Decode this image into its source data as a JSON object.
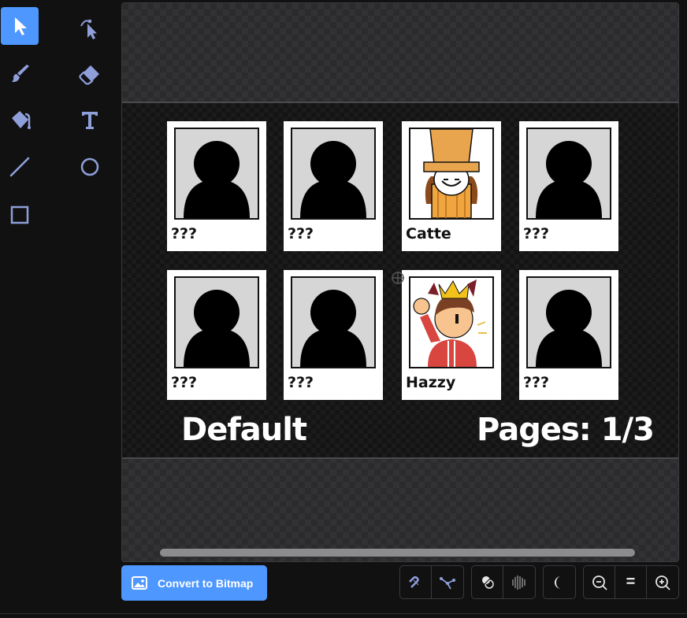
{
  "toolbar": {
    "tools": [
      {
        "name": "select",
        "icon": "arrow-icon",
        "selected": true
      },
      {
        "name": "reshape",
        "icon": "reshape-icon",
        "selected": false
      },
      {
        "name": "brush",
        "icon": "brush-icon",
        "selected": false
      },
      {
        "name": "eraser",
        "icon": "eraser-icon",
        "selected": false
      },
      {
        "name": "fill",
        "icon": "fill-bucket-icon",
        "selected": false
      },
      {
        "name": "text",
        "icon": "text-icon",
        "selected": false
      },
      {
        "name": "line",
        "icon": "line-icon",
        "selected": false
      },
      {
        "name": "circle",
        "icon": "circle-icon",
        "selected": false
      },
      {
        "name": "rectangle",
        "icon": "rectangle-icon",
        "selected": false
      }
    ],
    "selected_color": "#4d97ff"
  },
  "canvas": {
    "cards": [
      {
        "name": "???",
        "portrait": "silhouette"
      },
      {
        "name": "???",
        "portrait": "silhouette"
      },
      {
        "name": "Catte",
        "portrait": "catte"
      },
      {
        "name": "???",
        "portrait": "silhouette"
      },
      {
        "name": "???",
        "portrait": "silhouette"
      },
      {
        "name": "???",
        "portrait": "silhouette"
      },
      {
        "name": "Hazzy",
        "portrait": "hazzy"
      },
      {
        "name": "???",
        "portrait": "silhouette"
      }
    ],
    "left_label": "Default",
    "right_label": "Pages: 1/3"
  },
  "bottom_bar": {
    "convert_label": "Convert to Bitmap",
    "zoom_reset_label": "="
  }
}
